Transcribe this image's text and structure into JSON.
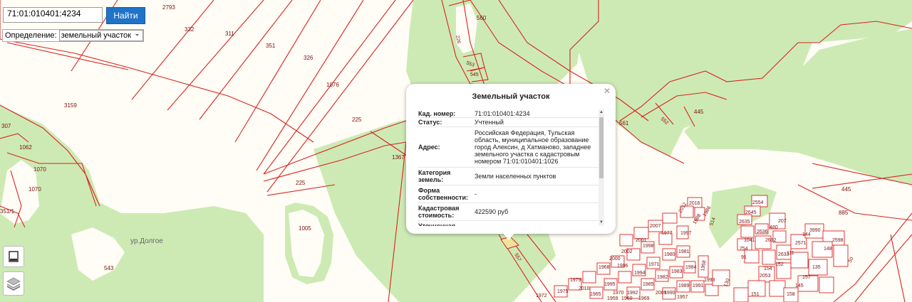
{
  "search": {
    "value": "71:01:010401:4234",
    "button_label": "Найти"
  },
  "definition": {
    "label": "Определение:",
    "selected": "земельный участок"
  },
  "map": {
    "place_label": "ур.Долгое",
    "parcel_numbers": [
      "2793",
      "332",
      "311",
      "351",
      "326",
      "1076",
      "3159",
      "225",
      "225",
      "1367",
      "307",
      "1062",
      "1070",
      "1070",
      "351/1",
      "1005",
      "543",
      "560",
      "226",
      "553",
      "545",
      "561",
      "552",
      "445",
      "445",
      "885",
      "2016",
      "2012",
      "1986",
      "1988",
      "2007",
      "1977",
      "1997",
      "1998",
      "2001",
      "2002",
      "2000",
      "1968",
      "1996",
      "1994",
      "1995",
      "1972",
      "1975",
      "1979",
      "2010",
      "1965",
      "1971",
      "1980",
      "1981",
      "1982",
      "1983",
      "1984",
      "1985",
      "1989",
      "1990",
      "1991",
      "1992",
      "1993",
      "2009",
      "1970",
      "1969",
      "1960",
      "1959",
      "1957",
      "1958",
      "557",
      "2554",
      "2645",
      "2635",
      "2636",
      "2632",
      "207",
      "480",
      "1041",
      "754",
      "91",
      "2633",
      "2053",
      "152",
      "154",
      "111",
      "2571",
      "157",
      "145",
      "158",
      "151",
      "148",
      "144",
      "2598",
      "135",
      "50",
      "3990",
      "514",
      "130",
      "1986",
      "2624"
    ]
  },
  "popup": {
    "title": "Земельный участок",
    "rows": [
      {
        "key": "Кад. номер:",
        "value": "71:01:010401:4234"
      },
      {
        "key": "Статус:",
        "value": "Учтенный"
      },
      {
        "key": "Адрес:",
        "value": "Российская Федерация, Тульская область, муниципальное образование город Алексин, д Хатманово, западнее земельного участка с кадастровым номером 71:01:010401:1026"
      },
      {
        "key": "Категория земель:",
        "value": "Земли населенных пунктов"
      },
      {
        "key": "Форма собственности:",
        "value": "-"
      },
      {
        "key": "Кадастровая стоимость:",
        "value": "422590 руб"
      },
      {
        "key": "Уточненная",
        "value": ""
      }
    ]
  },
  "colors": {
    "boundary": "#d92323",
    "forest": "#cdeab4",
    "background": "#fffdf5",
    "button": "#1f73c8"
  },
  "icons": {
    "close": "close-icon",
    "legend": "legend-icon",
    "layers": "layers-icon"
  }
}
